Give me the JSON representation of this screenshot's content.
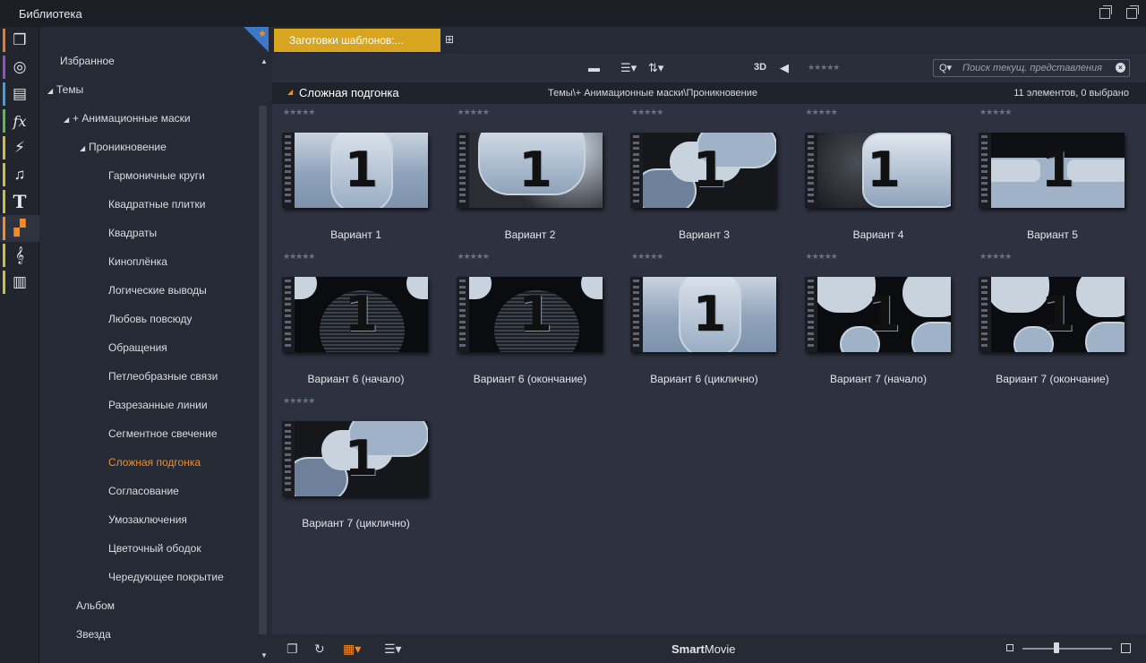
{
  "window": {
    "title": "Библиотека"
  },
  "rail": {
    "items": [
      {
        "icon": "layers-icon",
        "glyph": "❒",
        "color": "#e8782a"
      },
      {
        "icon": "film-reel-icon",
        "glyph": "◎",
        "color": "#8e4ec6"
      },
      {
        "icon": "photos-icon",
        "glyph": "▤",
        "color": "#3aa3d8"
      },
      {
        "icon": "fx-icon",
        "glyph": "fx",
        "color": "#5dbb45"
      },
      {
        "icon": "lightning-icon",
        "glyph": "⚡",
        "color": "#c6c23a"
      },
      {
        "icon": "music-note-icon",
        "glyph": "♫",
        "color": "#c6c23a"
      },
      {
        "icon": "title-text-icon",
        "glyph": "T",
        "color": "#c6c23a"
      },
      {
        "icon": "montage-templates-icon",
        "glyph": "▞",
        "color": "#f28c28"
      },
      {
        "icon": "treble-clef-icon",
        "glyph": "𝄞",
        "color": "#c6c23a"
      },
      {
        "icon": "piano-keys-icon",
        "glyph": "▥",
        "color": "#c6c23a"
      }
    ]
  },
  "tree": {
    "items": [
      {
        "label": "Избранное",
        "level": 0,
        "caret": ""
      },
      {
        "label": "Темы",
        "level": 0,
        "caret": "◢"
      },
      {
        "label": "+ Анимационные маски",
        "level": 1,
        "caret": "◢"
      },
      {
        "label": "Проникновение",
        "level": 2,
        "caret": "◢"
      },
      {
        "label": "Гармоничные круги",
        "level": 3,
        "caret": ""
      },
      {
        "label": "Квадратные плитки",
        "level": 3,
        "caret": ""
      },
      {
        "label": "Квадраты",
        "level": 3,
        "caret": ""
      },
      {
        "label": "Киноплёнка",
        "level": 3,
        "caret": ""
      },
      {
        "label": "Логические выводы",
        "level": 3,
        "caret": ""
      },
      {
        "label": "Любовь повсюду",
        "level": 3,
        "caret": ""
      },
      {
        "label": "Обращения",
        "level": 3,
        "caret": ""
      },
      {
        "label": "Петлеобразные связи",
        "level": 3,
        "caret": ""
      },
      {
        "label": "Разрезанные линии",
        "level": 3,
        "caret": ""
      },
      {
        "label": "Сегментное свечение",
        "level": 3,
        "caret": ""
      },
      {
        "label": "Сложная подгонка",
        "level": 3,
        "caret": "",
        "selected": true
      },
      {
        "label": "Согласование",
        "level": 3,
        "caret": ""
      },
      {
        "label": "Умозаключения",
        "level": 3,
        "caret": ""
      },
      {
        "label": "Цветочный ободок",
        "level": 3,
        "caret": ""
      },
      {
        "label": "Чередующее покрытие",
        "level": 3,
        "caret": ""
      },
      {
        "label": "Альбом",
        "level": 1,
        "caret": ""
      },
      {
        "label": "Звезда",
        "level": 1,
        "caret": ""
      }
    ]
  },
  "tab": {
    "label": "Заготовки шаблонов:..."
  },
  "toolbar": {
    "three_d_label": "3D",
    "rating_stars": "★★★★★",
    "search_placeholder": "Поиск текущ. представления"
  },
  "pathbar": {
    "name": "Сложная подгонка",
    "path": "Темы\\+ Анимационные маски\\Проникновение",
    "count": "11 элементов, 0 выбрано"
  },
  "grid": {
    "items": [
      {
        "label": "Вариант 1",
        "stars": "★★★★★",
        "number": "1",
        "style": "a"
      },
      {
        "label": "Вариант 2",
        "stars": "★★★★★",
        "number": "1",
        "style": "b"
      },
      {
        "label": "Вариант 3",
        "stars": "★★★★★",
        "number": "1",
        "style": "c"
      },
      {
        "label": "Вариант 4",
        "stars": "★★★★★",
        "number": "1",
        "style": "d"
      },
      {
        "label": "Вариант 5",
        "stars": "★★★★★",
        "number": "1",
        "style": "e"
      },
      {
        "label": "Вариант 6 (начало)",
        "stars": "★★★★★",
        "number": "1",
        "style": "f"
      },
      {
        "label": "Вариант 6 (окончание)",
        "stars": "★★★★★",
        "number": "1",
        "style": "f"
      },
      {
        "label": "Вариант 6 (циклично)",
        "stars": "★★★★★",
        "number": "1",
        "style": "a"
      },
      {
        "label": "Вариант 7 (начало)",
        "stars": "★★★★★",
        "number": "1",
        "style": "g"
      },
      {
        "label": "Вариант 7 (окончание)",
        "stars": "★★★★★",
        "number": "1",
        "style": "g"
      },
      {
        "label": "Вариант 7 (циклично)",
        "stars": "★★★★★",
        "number": "1",
        "style": "c"
      }
    ]
  },
  "bottombar": {
    "smart": "Smart",
    "movie": "Movie"
  },
  "colors": {
    "accent": "#f28c28",
    "tab": "#d8a520"
  }
}
